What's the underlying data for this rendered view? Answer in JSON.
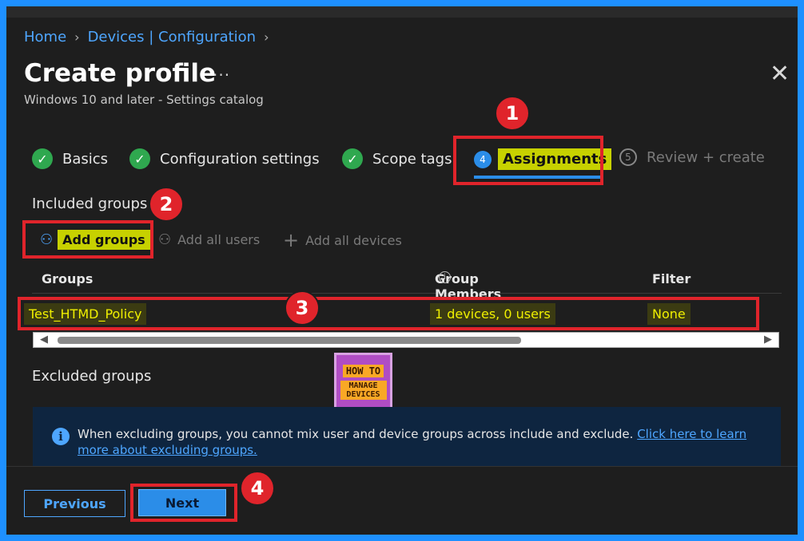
{
  "breadcrumb": [
    "Home",
    "Devices | Configuration"
  ],
  "title": "Create profile",
  "title_more": "···",
  "close_glyph": "✕",
  "subtitle": "Windows 10 and later - Settings catalog",
  "steps": [
    {
      "label": "Basics",
      "state": "done"
    },
    {
      "label": "Configuration settings",
      "state": "done"
    },
    {
      "label": "Scope tags",
      "state": "done"
    },
    {
      "label": "Assignments",
      "number": "4",
      "state": "active"
    },
    {
      "label": "Review + create",
      "number": "5",
      "state": "pending"
    }
  ],
  "included": {
    "heading": "Included groups",
    "commands": [
      {
        "label": "Add groups",
        "icon": "add-user-icon",
        "glyph": "⚇"
      },
      {
        "label": "Add all users",
        "icon": "users-icon",
        "glyph": "⚇"
      },
      {
        "label": "Add all devices",
        "icon": "plus-icon",
        "glyph": "+"
      }
    ],
    "columns": [
      "Groups",
      "Group Members",
      "Filter"
    ],
    "rows": [
      {
        "group": "Test_HTMD_Policy",
        "members": "1 devices, 0 users",
        "filter": "None"
      }
    ]
  },
  "excluded": {
    "heading": "Excluded groups"
  },
  "info": {
    "icon": "info-icon",
    "text": "When excluding groups, you cannot mix user and device groups across include and exclude.",
    "link": "Click here to learn more about excluding groups."
  },
  "logo": {
    "line1": "HOW TO",
    "line2": "MANAGE DEVICES"
  },
  "annotations": [
    "1",
    "2",
    "3",
    "4"
  ],
  "buttons": {
    "previous": "Previous",
    "next": "Next"
  },
  "colors": {
    "accent": "#2b8de8",
    "highlight": "#c7d100",
    "annotation": "#e0242b",
    "border": "#1e90ff"
  }
}
